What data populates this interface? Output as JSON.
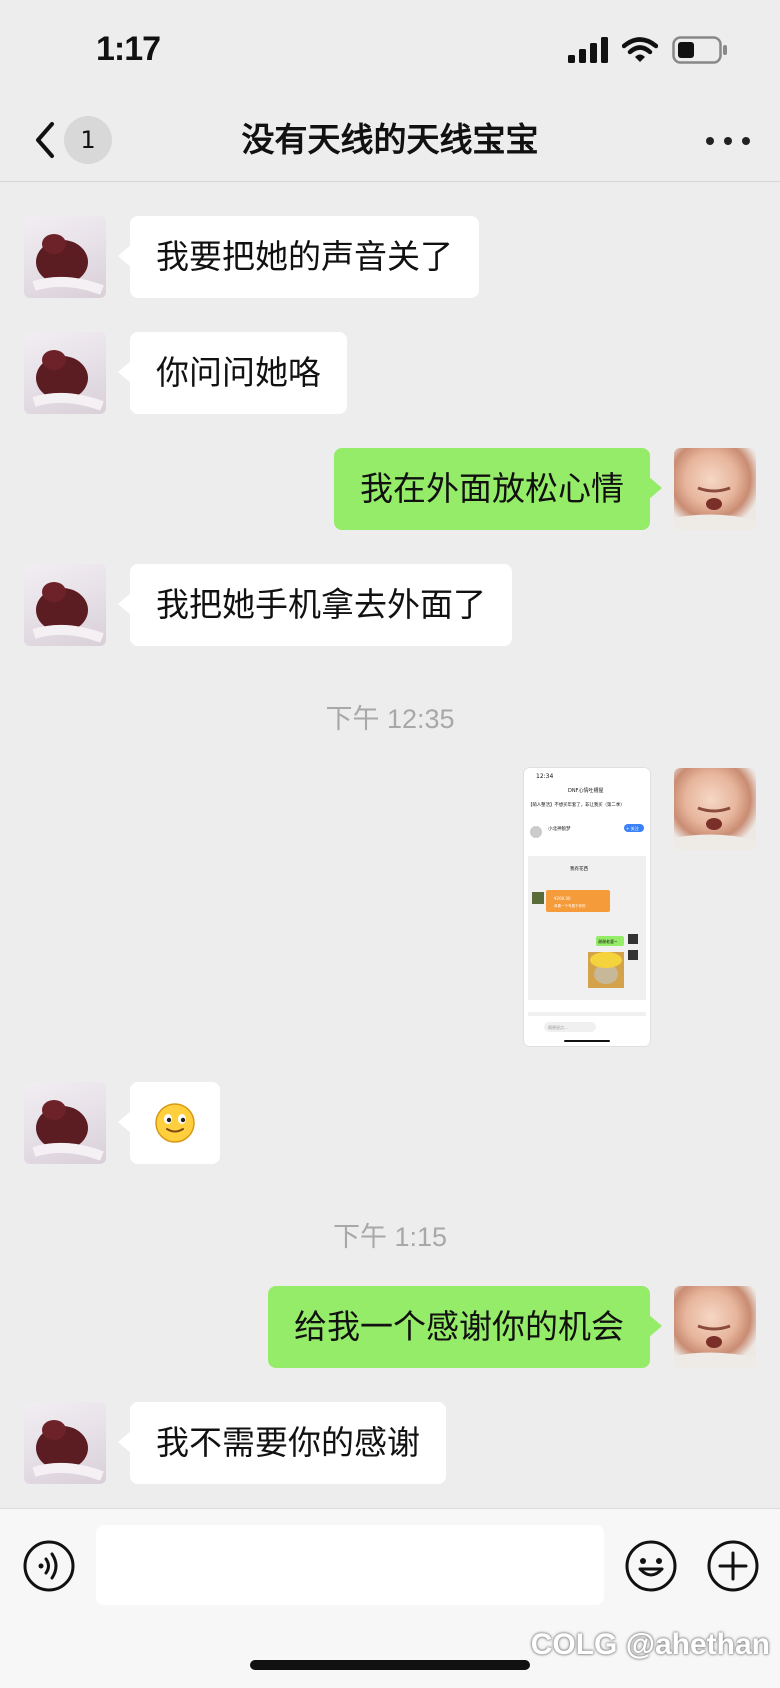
{
  "status_bar": {
    "time": "1:17"
  },
  "nav": {
    "unread_count": "1",
    "title": "没有天线的天线宝宝"
  },
  "messages": [
    {
      "side": "left",
      "text": "我要把她的声音关了"
    },
    {
      "side": "left",
      "text": "你问问她咯"
    },
    {
      "side": "right",
      "text": "我在外面放松心情"
    },
    {
      "side": "left",
      "text": "我把她手机拿去外面了"
    },
    {
      "timestamp": "下午 12:35"
    },
    {
      "side": "right",
      "type": "image"
    },
    {
      "side": "left",
      "type": "emoji",
      "emoji": "🙂"
    },
    {
      "timestamp": "下午 1:15"
    },
    {
      "side": "right",
      "text": "给我一个感谢你的机会"
    },
    {
      "side": "left",
      "text": "我不需要你的感谢"
    }
  ],
  "screenshot_thumb": {
    "time": "12:34",
    "title": "DNF心情吐槽屋",
    "post_line": "【萌人整活】不想买年套了，非让我买（第二季）",
    "author": "小北神狼梦",
    "follow": "+ 关注",
    "chat_title": "我有花西",
    "orange_amount": "¥200.00",
    "orange_note": "恭喜一个专属于你的",
    "green_text": "谢谢老婆~",
    "input_hint": "随便说点..."
  },
  "watermark": "COLG @ahethan",
  "colors": {
    "self_bubble": "#95ec69",
    "other_bubble": "#ffffff",
    "background": "#ededed"
  },
  "icons": [
    "signal-icon",
    "wifi-icon",
    "battery-icon",
    "back-arrow-icon",
    "more-icon",
    "voice-icon",
    "emoji-icon",
    "plus-icon"
  ]
}
